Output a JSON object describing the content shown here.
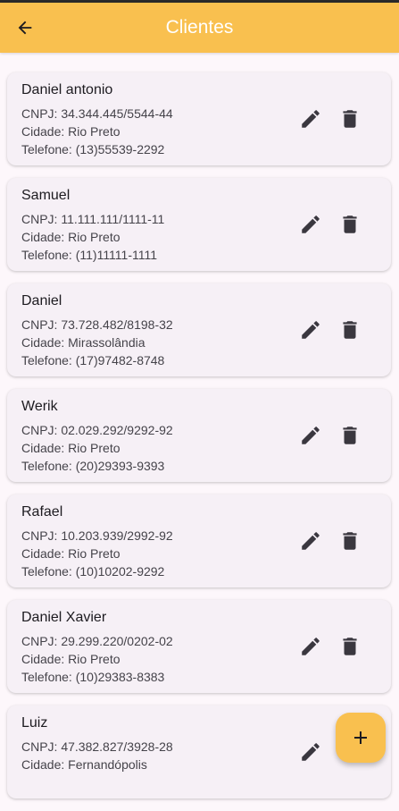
{
  "appbar": {
    "title": "Clientes",
    "back_icon": "arrow-left-icon",
    "color": "#f9c04f"
  },
  "clients": [
    {
      "name": "Daniel antonio",
      "cnpj": "CNPJ: 34.344.445/5544-44",
      "cidade": "Cidade: Rio Preto",
      "telefone": "Telefone: (13)55539-2292"
    },
    {
      "name": "Samuel",
      "cnpj": "CNPJ: 11.111.111/1111-11",
      "cidade": "Cidade: Rio Preto",
      "telefone": "Telefone: (11)11111-1111"
    },
    {
      "name": "Daniel",
      "cnpj": "CNPJ: 73.728.482/8198-32",
      "cidade": "Cidade: Mirassolândia",
      "telefone": "Telefone: (17)97482-8748"
    },
    {
      "name": "Werik",
      "cnpj": "CNPJ: 02.029.292/9292-92",
      "cidade": "Cidade: Rio Preto",
      "telefone": "Telefone: (20)29393-9393"
    },
    {
      "name": "Rafael",
      "cnpj": "CNPJ: 10.203.939/2992-92",
      "cidade": "Cidade: Rio Preto",
      "telefone": "Telefone: (10)10202-9292"
    },
    {
      "name": "Daniel Xavier",
      "cnpj": "CNPJ: 29.299.220/0202-02",
      "cidade": "Cidade: Rio Preto",
      "telefone": "Telefone: (10)29383-8383"
    },
    {
      "name": "Luiz",
      "cnpj": "CNPJ: 47.382.827/3928-28",
      "cidade": "Cidade: Fernandópolis",
      "telefone": ""
    }
  ],
  "actions": {
    "edit_icon": "pencil-icon",
    "delete_icon": "trash-icon",
    "add_icon": "plus-icon"
  }
}
